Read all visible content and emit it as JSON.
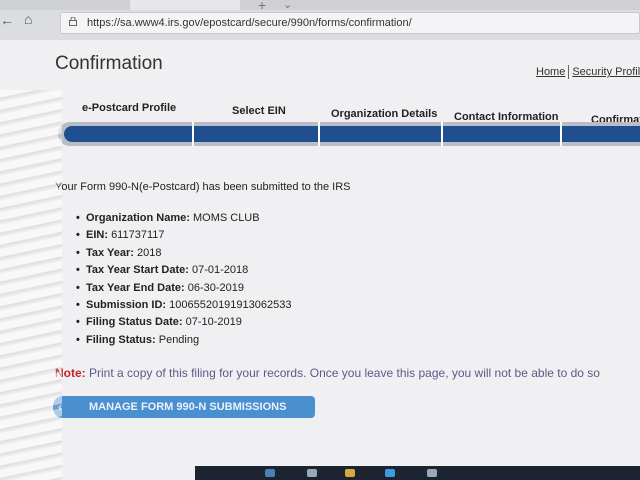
{
  "browser": {
    "url": "https://sa.www4.irs.gov/epostcard/secure/990n/forms/confirmation/"
  },
  "page": {
    "title": "Confirmation",
    "links": {
      "home": "Home",
      "security": "Security Profile"
    }
  },
  "steps": [
    {
      "label": "e-Postcard Profile"
    },
    {
      "label": "Select EIN"
    },
    {
      "label": "Organization Details"
    },
    {
      "label": "Contact Information"
    },
    {
      "label": "Confirmation"
    }
  ],
  "message": "Your Form 990-N(e-Postcard) has been submitted to the IRS",
  "details": [
    {
      "label": "Organization Name:",
      "value": "MOMS CLUB"
    },
    {
      "label": "EIN:",
      "value": "611737117"
    },
    {
      "label": "Tax Year:",
      "value": "2018"
    },
    {
      "label": "Tax Year Start Date:",
      "value": "07-01-2018"
    },
    {
      "label": "Tax Year End Date:",
      "value": "06-30-2019"
    },
    {
      "label": "Submission ID:",
      "value": "10065520191913062533"
    },
    {
      "label": "Filing Status Date:",
      "value": "07-10-2019"
    },
    {
      "label": "Filing Status:",
      "value": "Pending"
    }
  ],
  "note": {
    "label": "Note:",
    "text": "Print a copy of this filing for your records. Once you leave this page, you will not be able to do so"
  },
  "button": {
    "manage": "MANAGE FORM 990-N SUBMISSIONS"
  },
  "colors": {
    "progress": "#1f4e91",
    "note_label": "#c0222e",
    "button": "#4a8fd0"
  },
  "icons": {
    "back": "back-arrow-icon",
    "home": "home-icon",
    "lock": "lock-icon",
    "button": "chevron-left-icon"
  }
}
